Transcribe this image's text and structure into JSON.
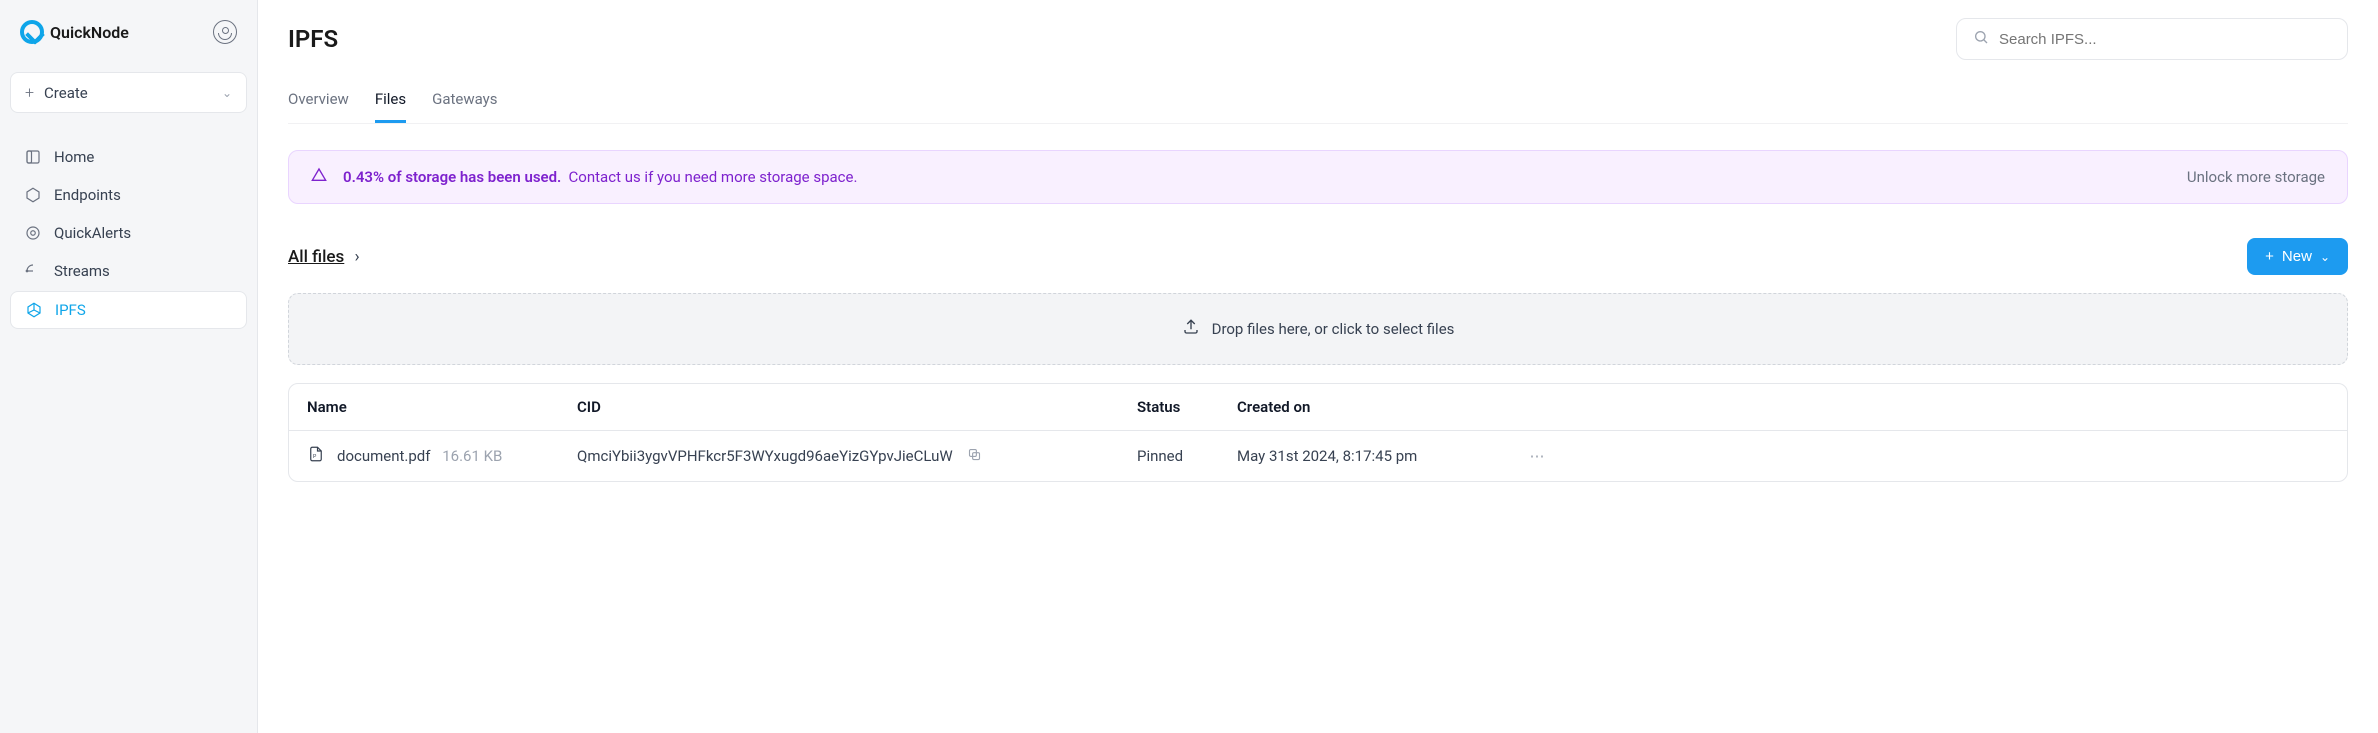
{
  "brand": "QuickNode",
  "create_label": "Create",
  "nav": {
    "home": "Home",
    "endpoints": "Endpoints",
    "quickalerts": "QuickAlerts",
    "streams": "Streams",
    "ipfs": "IPFS"
  },
  "page_title": "IPFS",
  "search_placeholder": "Search IPFS...",
  "tabs": {
    "overview": "Overview",
    "files": "Files",
    "gateways": "Gateways"
  },
  "alert": {
    "strong": "0.43% of storage has been used.",
    "text": "Contact us if you need more storage space.",
    "link": "Unlock more storage"
  },
  "breadcrumb": {
    "all_files": "All files",
    "sep": "›"
  },
  "new_label": "New",
  "dropzone": "Drop files here, or click to select files",
  "columns": {
    "name": "Name",
    "cid": "CID",
    "status": "Status",
    "created": "Created on"
  },
  "rows": [
    {
      "name": "document.pdf",
      "size": "16.61 KB",
      "cid": "QmciYbii3ygvVPHFkcr5F3WYxugd96aeYizGYpvJieCLuW",
      "status": "Pinned",
      "created": "May 31st 2024, 8:17:45 pm"
    }
  ]
}
